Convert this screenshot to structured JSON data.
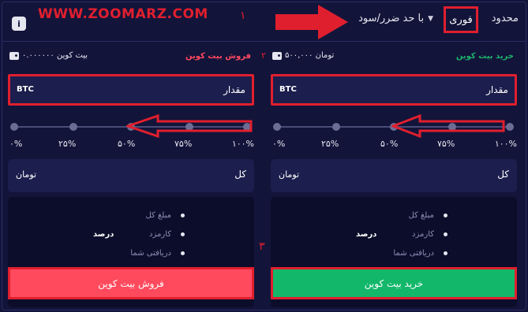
{
  "header": {
    "tabs": [
      {
        "label": "محدود"
      },
      {
        "label": "فوری"
      },
      {
        "label": "با حد ضرر/سود"
      }
    ],
    "info_label": "i",
    "watermark": "WWW.ZOOMARZ.COM",
    "annotation_1": "١"
  },
  "buy": {
    "title": "خرید بیت کوین",
    "balance": "۵۰۰,۰۰۰ تومان",
    "amount_label": "مقدار",
    "amount_unit": "BTC",
    "ticks": [
      "۱۰۰%",
      "۷۵%",
      "۵۰%",
      "۲۵%",
      "۰%"
    ],
    "total_label": "کل",
    "total_unit": "تومان",
    "summary": [
      {
        "label": "مبلغ کل",
        "value": ""
      },
      {
        "label": "کارمزد",
        "value": "درصد"
      },
      {
        "label": "دریافتی شما",
        "value": ""
      }
    ],
    "button_label": "خرید بیت کوین"
  },
  "sell": {
    "title": "فروش بیت کوین",
    "balance": "۰.۰۰۰۰۰۰ بیت کوین",
    "amount_label": "مقدار",
    "amount_unit": "BTC",
    "ticks": [
      "۱۰۰%",
      "۷۵%",
      "۵۰%",
      "۲۵%",
      "۰%"
    ],
    "total_label": "کل",
    "total_unit": "تومان",
    "summary": [
      {
        "label": "مبلغ کل",
        "value": ""
      },
      {
        "label": "کارمزد",
        "value": "درصد"
      },
      {
        "label": "دریافتی شما",
        "value": ""
      }
    ],
    "button_label": "فروش بیت کوین"
  },
  "annotations": {
    "num_2": "٢",
    "num_3": "٣"
  },
  "colors": {
    "background": "#13143a",
    "buy_green": "#12b76a",
    "sell_red": "#ff4a5e",
    "annotation_red": "#e01f2e"
  }
}
